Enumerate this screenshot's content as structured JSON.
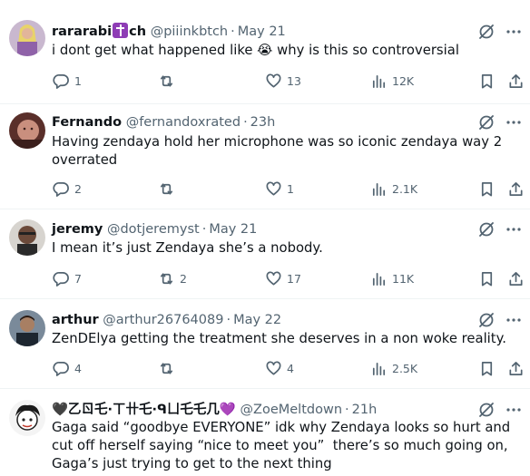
{
  "tweets": [
    {
      "name": "rararabi",
      "name_suffix": "ch",
      "handle": "@piiinkbtch",
      "separator": "·",
      "time": "May 21",
      "text": "i dont get what happened like 😭 why is this so controversial",
      "replies": "1",
      "retweets": "",
      "likes": "13",
      "views": "12K"
    },
    {
      "name": "Fernando",
      "handle": "@fernandoxrated",
      "separator": "·",
      "time": "23h",
      "text": "Having zendaya hold her microphone was so iconic zendaya way 2 overrated",
      "replies": "2",
      "retweets": "",
      "likes": "1",
      "views": "2.1K"
    },
    {
      "name": "jeremy",
      "handle": "@dotjeremyst",
      "separator": "·",
      "time": "May 21",
      "text": "I mean it’s just Zendaya she’s a nobody.",
      "replies": "7",
      "retweets": "2",
      "likes": "17",
      "views": "11K"
    },
    {
      "name": "arthur",
      "handle": "@arthur26764089",
      "separator": "·",
      "time": "May 22",
      "text": "ZenDElya getting the treatment she deserves in a non woke reality.",
      "replies": "4",
      "retweets": "",
      "likes": "4",
      "views": "2.5K"
    },
    {
      "name": "🖤乙ㄖ乇·ㄒ卄乇·ᑫㄩ乇乇几💜",
      "handle": "@ZoeMeltdown",
      "separator": "·",
      "time": "21h",
      "text": "Gaga said “goodbye EVERYONE” idk why Zendaya looks so hurt and cut off herself saying “nice to meet you”  there’s so much going on, Gaga’s just trying to get to the next thing"
    }
  ],
  "icons": {
    "grok": "grok-icon",
    "share": "share-icon",
    "bookmark": "bookmark-icon",
    "reply": "reply-icon",
    "retweet": "retweet-icon",
    "like": "heart-icon",
    "views": "views-icon"
  },
  "colors": {
    "text": "#0f1419",
    "muted": "#536471",
    "divider": "#eff3f4",
    "badge": "#8e3db5"
  }
}
